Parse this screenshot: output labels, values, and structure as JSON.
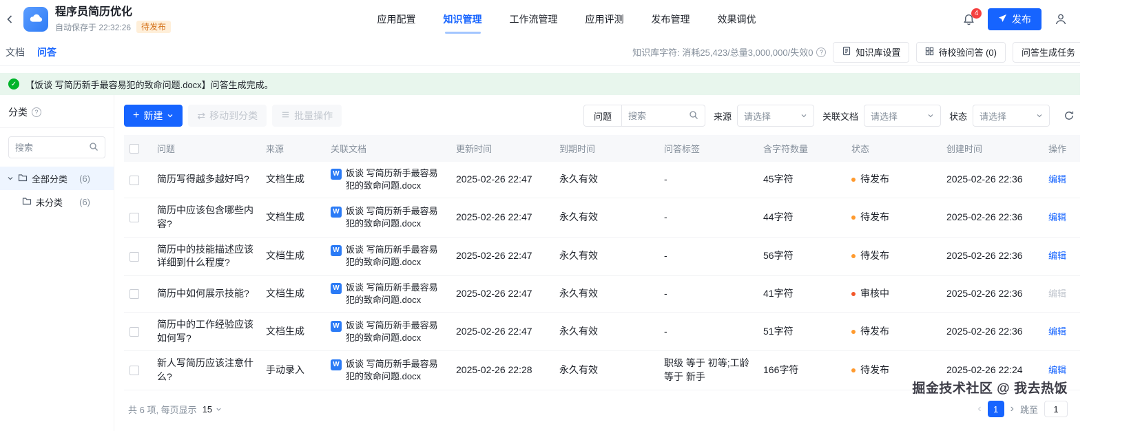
{
  "colors": {
    "primary": "#1664ff",
    "success": "#00b42a",
    "pending_dot": "#ff9a2e",
    "review_dot": "#f2572a"
  },
  "header": {
    "app_title": "程序员简历优化",
    "autosave": "自动保存于 22:32:26",
    "status_badge": "待发布",
    "nav": [
      {
        "label": "应用配置",
        "active": false
      },
      {
        "label": "知识管理",
        "active": true
      },
      {
        "label": "工作流管理",
        "active": false
      },
      {
        "label": "应用评测",
        "active": false
      },
      {
        "label": "发布管理",
        "active": false
      },
      {
        "label": "效果调优",
        "active": false
      }
    ],
    "notification_count": "4",
    "publish_label": "发布"
  },
  "subnav": {
    "doc_tab": "文档",
    "qa_tab": "问答",
    "quota": "知识库字符: 消耗25,423/总量3,000,000/失效0",
    "kb_settings": "知识库设置",
    "pending_verify": "待校验问答 (0)",
    "qa_task": "问答生成任务"
  },
  "banner": {
    "message": "【饭谈 写简历新手最容易犯的致命问题.docx】问答生成完成。"
  },
  "sidebar": {
    "title": "分类",
    "search_placeholder": "搜索",
    "items": [
      {
        "label": "全部分类",
        "count": "(6)",
        "selected": true
      },
      {
        "label": "未分类",
        "count": "(6)",
        "selected": false
      }
    ]
  },
  "toolbar": {
    "new_label": "新建",
    "move_label": "移动到分类",
    "batch_label": "批量操作",
    "search_category": "问题",
    "search_placeholder": "搜索",
    "filter_source_label": "来源",
    "filter_source_value": "请选择",
    "filter_doc_label": "关联文档",
    "filter_doc_value": "请选择",
    "filter_status_label": "状态",
    "filter_status_value": "请选择"
  },
  "table": {
    "headers": [
      "问题",
      "来源",
      "关联文档",
      "更新时间",
      "到期时间",
      "问答标签",
      "含字符数量",
      "状态",
      "创建时间",
      "操作"
    ],
    "doc_icon": "W",
    "rows": [
      {
        "question": "简历写得越多越好吗?",
        "source": "文档生成",
        "doc": "饭谈 写简历新手最容易犯的致命问题.docx",
        "updated": "2025-02-26 22:47",
        "expires": "永久有效",
        "tags": "-",
        "chars": "45字符",
        "status": "待发布",
        "status_color": "#ff9a2e",
        "created": "2025-02-26 22:36",
        "action": "编辑",
        "action_color": "#1664ff"
      },
      {
        "question": "简历中应该包含哪些内容?",
        "source": "文档生成",
        "doc": "饭谈 写简历新手最容易犯的致命问题.docx",
        "updated": "2025-02-26 22:47",
        "expires": "永久有效",
        "tags": "-",
        "chars": "44字符",
        "status": "待发布",
        "status_color": "#ff9a2e",
        "created": "2025-02-26 22:36",
        "action": "编辑",
        "action_color": "#1664ff"
      },
      {
        "question": "简历中的技能描述应该详细到什么程度?",
        "source": "文档生成",
        "doc": "饭谈 写简历新手最容易犯的致命问题.docx",
        "updated": "2025-02-26 22:47",
        "expires": "永久有效",
        "tags": "-",
        "chars": "56字符",
        "status": "待发布",
        "status_color": "#ff9a2e",
        "created": "2025-02-26 22:36",
        "action": "编辑",
        "action_color": "#1664ff"
      },
      {
        "question": "简历中如何展示技能?",
        "source": "文档生成",
        "doc": "饭谈 写简历新手最容易犯的致命问题.docx",
        "updated": "2025-02-26 22:47",
        "expires": "永久有效",
        "tags": "-",
        "chars": "41字符",
        "status": "审核中",
        "status_color": "#f2572a",
        "created": "2025-02-26 22:36",
        "action": "编辑",
        "action_color": "#c2c7cf"
      },
      {
        "question": "简历中的工作经验应该如何写?",
        "source": "文档生成",
        "doc": "饭谈 写简历新手最容易犯的致命问题.docx",
        "updated": "2025-02-26 22:47",
        "expires": "永久有效",
        "tags": "-",
        "chars": "51字符",
        "status": "待发布",
        "status_color": "#ff9a2e",
        "created": "2025-02-26 22:36",
        "action": "编辑",
        "action_color": "#1664ff"
      },
      {
        "question": "新人写简历应该注意什么?",
        "source": "手动录入",
        "doc": "饭谈 写简历新手最容易犯的致命问题.docx",
        "updated": "2025-02-26 22:28",
        "expires": "永久有效",
        "tags": "职级 等于 初等;工龄 等于 新手",
        "chars": "166字符",
        "status": "待发布",
        "status_color": "#ff9a2e",
        "created": "2025-02-26 22:24",
        "action": "编辑",
        "action_color": "#1664ff"
      }
    ]
  },
  "footer": {
    "total_text": "共 6 项, 每页显示",
    "page_size": "15",
    "current_page": "1",
    "jump_label": "跳至",
    "jump_value": "1"
  },
  "watermark": {
    "text": "掘金技术社区 @ 我去热饭"
  }
}
